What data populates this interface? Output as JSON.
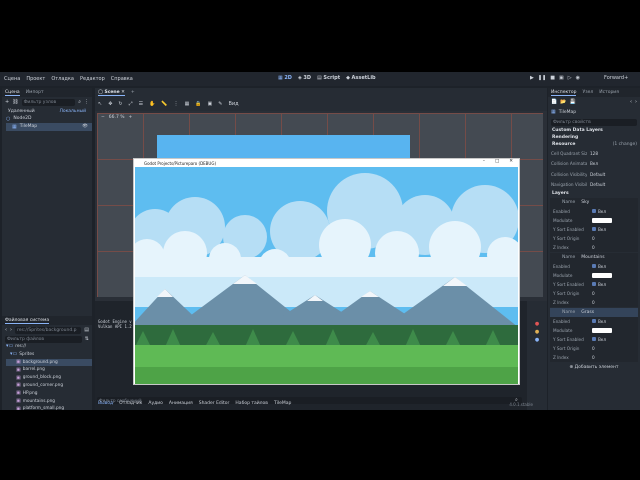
{
  "menu": [
    "Сцена",
    "Проект",
    "Отладка",
    "Редактор",
    "Справка"
  ],
  "modes": [
    "2D",
    "3D",
    "Script",
    "AssetLib"
  ],
  "renderer": "Forward+",
  "scene_dock": {
    "tabs": [
      "Сцена",
      "Импорт"
    ],
    "filter_placeholder": "Фильтр узлов",
    "subtabs": [
      "Удаленный",
      "Локальный"
    ],
    "nodes": [
      "Node2D",
      "TileMap"
    ]
  },
  "fs_dock": {
    "title": "Файловая система",
    "path": "res://Sprites/background.p",
    "filter_placeholder": "Фильтр файлов",
    "root": "res://",
    "folder": "Sprites",
    "files": [
      "background.png",
      "barrel.png",
      "ground_block.png",
      "ground_corner.png",
      "HP.png",
      "mountains.png",
      "platform_small.png",
      "platform_big.png",
      "rock.png",
      "sky.png",
      "tree.png",
      "wisp.png"
    ]
  },
  "scene_tab": "Scene",
  "toolbar_view": "Вид",
  "zoom": "66.7 %",
  "game_window": {
    "title": "Godot Projects/Pictureparo (DEBUG)",
    "min": "–",
    "max": "□",
    "close": "✕"
  },
  "output": {
    "lines": [
      "Godot Engine v",
      "Vulkan API 1.2"
    ],
    "filter_placeholder": "Фильтр сообщений",
    "tabs": [
      "Вывод",
      "Отладчик",
      "Аудио",
      "Анимация",
      "Shader Editor",
      "Набор тайлов",
      "TileMap"
    ],
    "version": "4.0.1.stable"
  },
  "inspector": {
    "tabs": [
      "Инспектор",
      "Узел",
      "История"
    ],
    "node": "TileMap",
    "filter_placeholder": "Фильтр свойств",
    "sections": [
      "Custom Data Layers",
      "Rendering",
      "Resource"
    ],
    "resource_value": "(1 change)",
    "props": [
      {
        "k": "Cell Quadrant Size",
        "v": "128"
      },
      {
        "k": "Collision Animatable",
        "v": "Вкл"
      },
      {
        "k": "Collision Visibility",
        "v": "Default"
      },
      {
        "k": "Navigation Visibility",
        "v": "Default"
      }
    ],
    "layers_title": "Layers",
    "layers": [
      {
        "name_label": "Name",
        "name": "Sky",
        "enabled": "Enabled",
        "on": "Вкл",
        "modulate": "Modulate",
        "ysort": "Y Sort Enabled",
        "yorigin": "Y Sort Origin",
        "yval": "0",
        "zindex": "Z Index",
        "zval": "0"
      },
      {
        "name_label": "Name",
        "name": "Mountains",
        "enabled": "Enabled",
        "on": "Вкл",
        "modulate": "Modulate",
        "ysort": "Y Sort Enabled",
        "yorigin": "Y Sort Origin",
        "yval": "0",
        "zindex": "Z Index",
        "zval": "0"
      },
      {
        "name_label": "Name",
        "name": "Grass",
        "enabled": "Enabled",
        "on": "Вкл",
        "modulate": "Modulate",
        "ysort": "Y Sort Enabled",
        "yorigin": "Y Sort Origin",
        "yval": "0",
        "zindex": "Z Index",
        "zval": "0"
      }
    ],
    "add_button": "Добавить элемент"
  }
}
